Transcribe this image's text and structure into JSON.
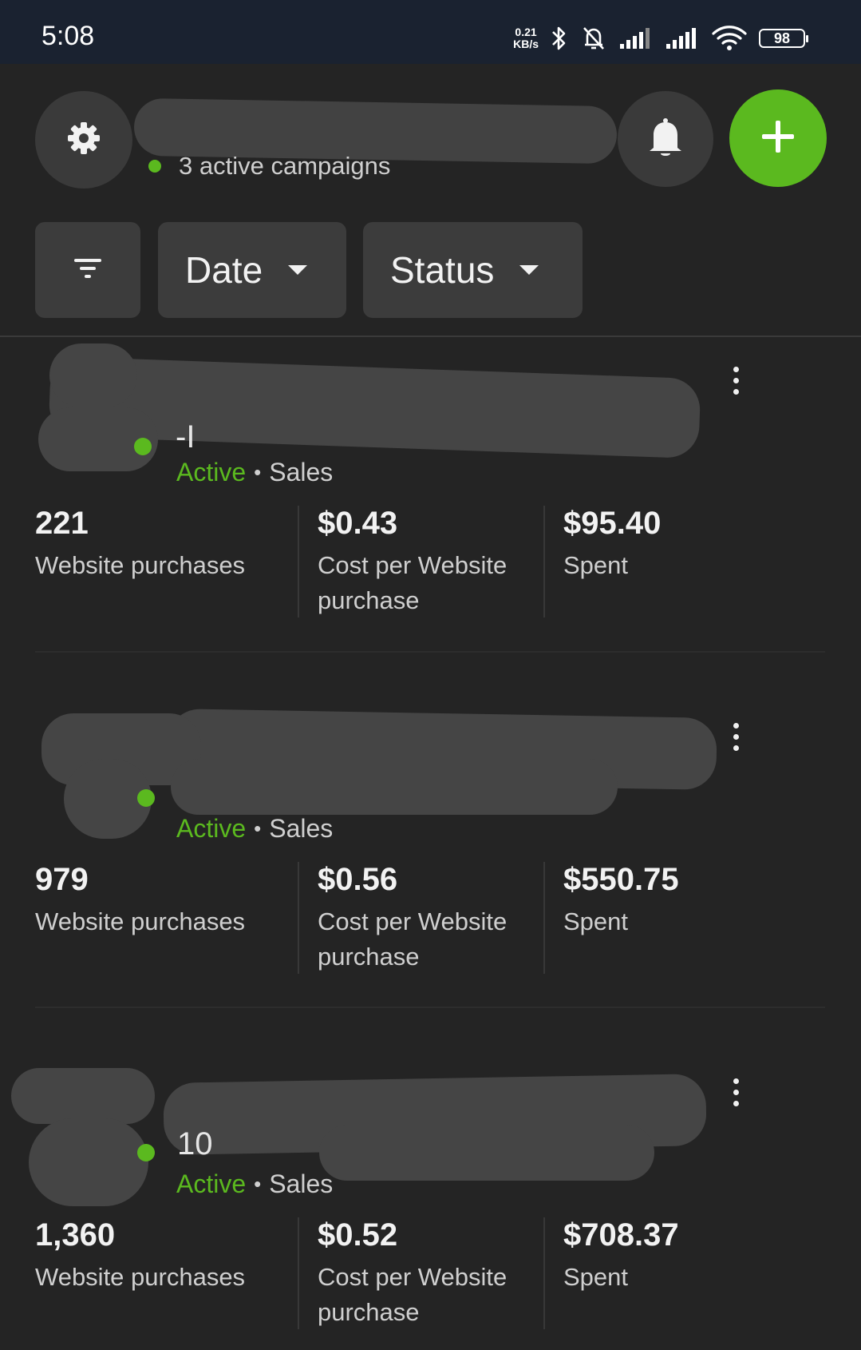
{
  "status_bar": {
    "time": "5:08",
    "net_speed_value": "0.21",
    "net_speed_unit": "KB/s",
    "battery": "98",
    "icons": [
      "bluetooth-icon",
      "muted-bell-icon",
      "signal-icon",
      "signal-icon",
      "wifi-icon",
      "battery-icon"
    ]
  },
  "header": {
    "active_campaigns": "3 active campaigns",
    "accent_color": "#5bb91f"
  },
  "filters": {
    "date_label": "Date",
    "status_label": "Status"
  },
  "campaigns": [
    {
      "partial_name": "-I",
      "status": "Active",
      "separator": "•",
      "objective": "Sales",
      "metrics": [
        {
          "value": "221",
          "label": "Website purchases"
        },
        {
          "value": "$0.43",
          "label": "Cost per Website purchase"
        },
        {
          "value": "$95.40",
          "label": "Spent"
        }
      ]
    },
    {
      "partial_name": "",
      "status": "Active",
      "separator": "•",
      "objective": "Sales",
      "metrics": [
        {
          "value": "979",
          "label": "Website purchases"
        },
        {
          "value": "$0.56",
          "label": "Cost per Website purchase"
        },
        {
          "value": "$550.75",
          "label": "Spent"
        }
      ]
    },
    {
      "partial_name": "10",
      "status": "Active",
      "separator": "•",
      "objective": "Sales",
      "metrics": [
        {
          "value": "1,360",
          "label": "Website purchases"
        },
        {
          "value": "$0.52",
          "label": "Cost per Website purchase"
        },
        {
          "value": "$708.37",
          "label": "Spent"
        }
      ]
    }
  ]
}
